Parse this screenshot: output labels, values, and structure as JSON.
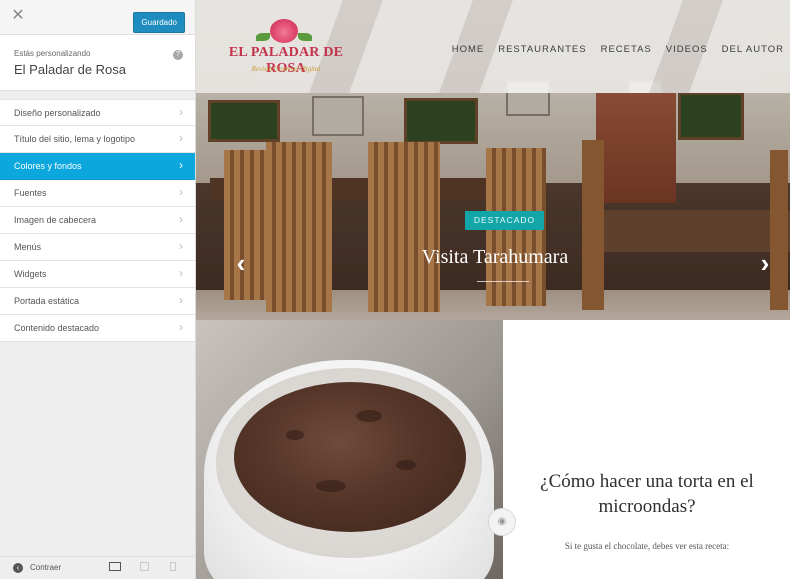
{
  "customizer": {
    "close_glyph": "✕",
    "save_label": "Guardado",
    "editing_label": "Estás personalizando",
    "site_name": "El Paladar de Rosa",
    "help_glyph": "?",
    "menu": [
      {
        "label": "Diseño personalizado",
        "active": false
      },
      {
        "label": "Título del sitio, lema y logotipo",
        "active": false
      },
      {
        "label": "Colores y fondos",
        "active": true
      },
      {
        "label": "Fuentes",
        "active": false
      },
      {
        "label": "Imagen de cabecera",
        "active": false
      },
      {
        "label": "Menús",
        "active": false
      },
      {
        "label": "Widgets",
        "active": false
      },
      {
        "label": "Portada estática",
        "active": false
      },
      {
        "label": "Contenido destacado",
        "active": false
      }
    ],
    "chevron_glyph": "›",
    "collapse_label": "Contraer",
    "accent_color": "#0ba7dd",
    "button_color": "#1e8cbe"
  },
  "site": {
    "logo": {
      "name": "EL PALADAR DE ROSA",
      "tagline": "Revista Gourmet Digital"
    },
    "nav": [
      "HOME",
      "RESTAURANTES",
      "RECETAS",
      "VIDEOS",
      "DEL AUTOR"
    ],
    "slider": {
      "badge": "DESTACADO",
      "title": "Visita Tarahumara",
      "prev_glyph": "‹",
      "next_glyph": "›",
      "badge_color": "#13a6a8"
    },
    "featured_post": {
      "title": "¿Cómo hacer una torta en el microondas?",
      "excerpt": "Si te gusta el chocolate, debes ver esta receta:",
      "camera_glyph": "◉"
    },
    "brand_color": "#c4324c"
  }
}
